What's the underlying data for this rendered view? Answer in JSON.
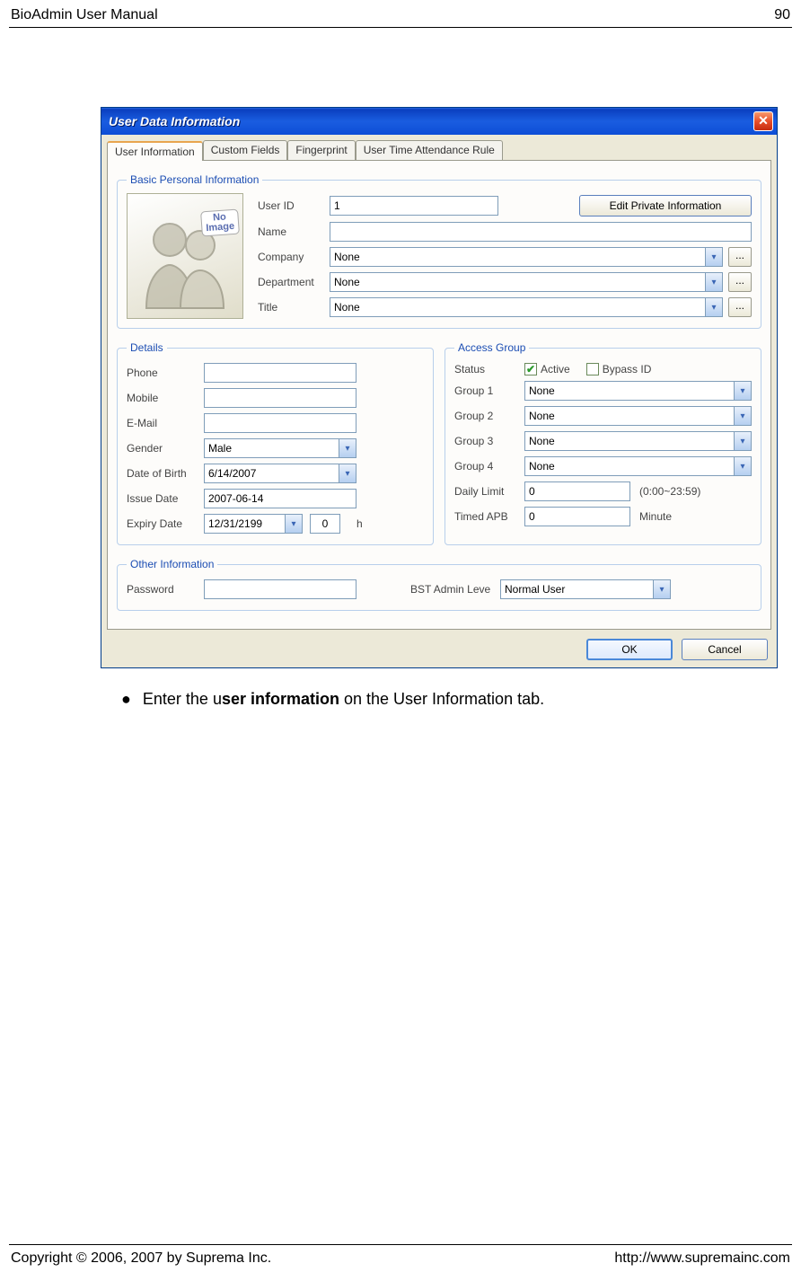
{
  "header": {
    "left": "BioAdmin User Manual",
    "right": "90"
  },
  "footer": {
    "left": "Copyright © 2006, 2007 by Suprema Inc.",
    "right": "http://www.supremainc.com"
  },
  "bullet": {
    "pre": "Enter the u",
    "bold": "ser information",
    "post": " on the User Information tab."
  },
  "dialog": {
    "title": "User Data Information",
    "tabs": [
      "User Information",
      "Custom Fields",
      "Fingerprint",
      "User Time Attendance Rule"
    ],
    "basic": {
      "legend": "Basic Personal Information",
      "noimg_line1": "No",
      "noimg_line2": "Image",
      "user_id_label": "User ID",
      "user_id_value": "1",
      "edit_private_btn": "Edit Private Information",
      "name_label": "Name",
      "name_value": "",
      "company_label": "Company",
      "company_value": "None",
      "department_label": "Department",
      "department_value": "None",
      "title_label": "Title",
      "title_value": "None",
      "ellipsis": "..."
    },
    "details": {
      "legend": "Details",
      "phone_label": "Phone",
      "phone_value": "",
      "mobile_label": "Mobile",
      "mobile_value": "",
      "email_label": "E-Mail",
      "email_value": "",
      "gender_label": "Gender",
      "gender_value": "Male",
      "dob_label": "Date of Birth",
      "dob_value": " 6/14/2007",
      "issue_label": "Issue Date",
      "issue_value": "2007-06-14",
      "expiry_label": "Expiry Date",
      "expiry_date": "12/31/2199",
      "expiry_h_value": "0",
      "expiry_h_unit": "h"
    },
    "access": {
      "legend": "Access Group",
      "status_label": "Status",
      "active_label": "Active",
      "active_checked": true,
      "bypass_label": "Bypass ID",
      "bypass_checked": false,
      "group1_label": "Group 1",
      "group1_value": "None",
      "group2_label": "Group 2",
      "group2_value": "None",
      "group3_label": "Group 3",
      "group3_value": "None",
      "group4_label": "Group 4",
      "group4_value": "None",
      "daily_label": "Daily Limit",
      "daily_value": "0",
      "daily_hint": "(0:00~23:59)",
      "apb_label": "Timed APB",
      "apb_value": "0",
      "apb_unit": "Minute"
    },
    "other": {
      "legend": "Other Information",
      "password_label": "Password",
      "password_value": "",
      "bst_label": "BST Admin Leve",
      "bst_value": "Normal User"
    },
    "buttons": {
      "ok": "OK",
      "cancel": "Cancel"
    }
  }
}
